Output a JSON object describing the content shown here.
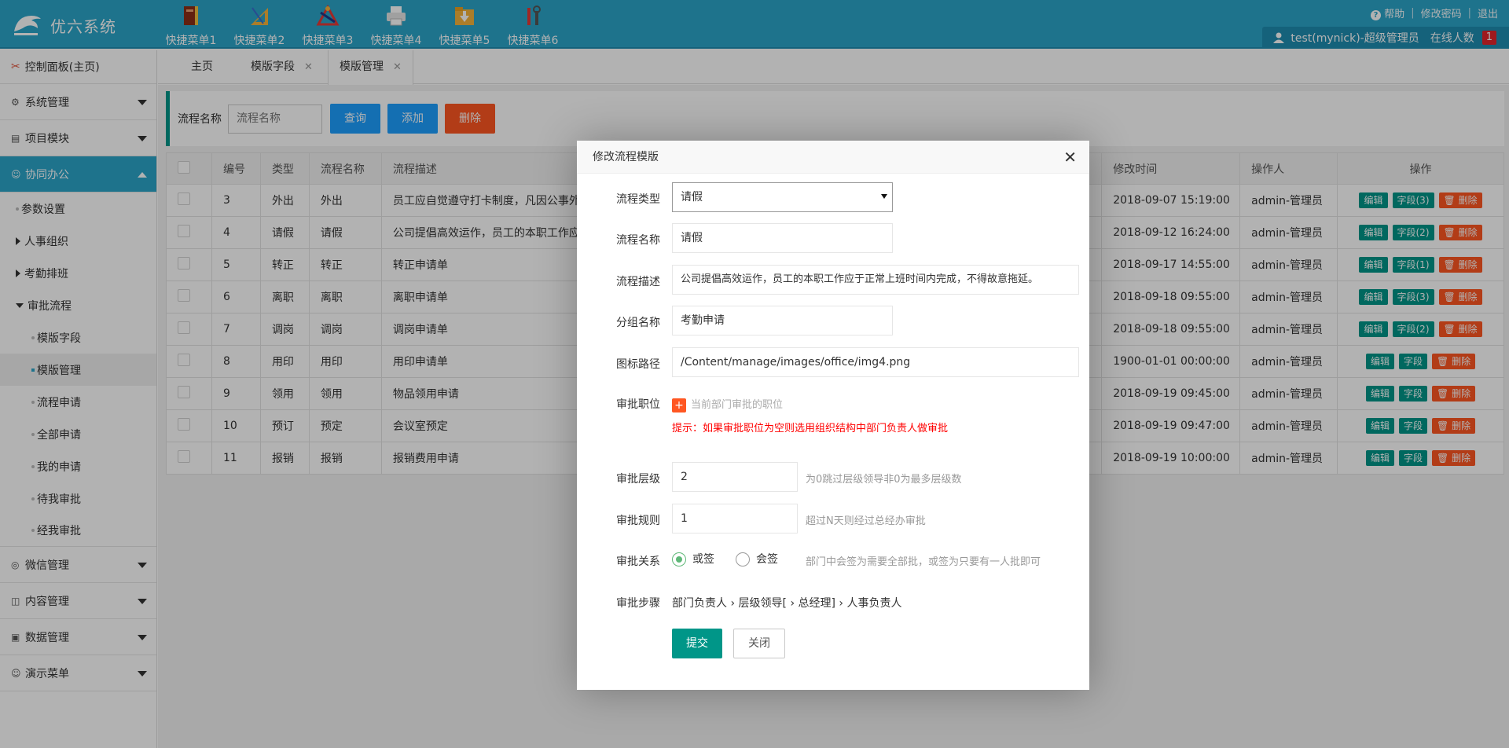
{
  "app": {
    "title": "优六系统",
    "quick_menus": [
      {
        "label": "快捷菜单1",
        "icon": "book-icon"
      },
      {
        "label": "快捷菜单2",
        "icon": "ruler-icon"
      },
      {
        "label": "快捷菜单3",
        "icon": "tools-icon"
      },
      {
        "label": "快捷菜单4",
        "icon": "printer-icon"
      },
      {
        "label": "快捷菜单5",
        "icon": "download-folder-icon"
      },
      {
        "label": "快捷菜单6",
        "icon": "wrench-icon"
      }
    ],
    "top_links": {
      "help": "帮助",
      "change_password": "修改密码",
      "logout": "退出"
    },
    "user": "test(mynick)-超级管理员",
    "online_label": "在线人数",
    "online_count": "1"
  },
  "sidebar": {
    "dashboard": "控制面板(主页)",
    "menus": {
      "system": "系统管理",
      "project": "项目模块",
      "office": "协同办公",
      "wechat": "微信管理",
      "content": "内容管理",
      "data": "数据管理",
      "demo": "演示菜单"
    },
    "office_items": {
      "params": "参数设置",
      "hr": "人事组织",
      "attendance": "考勤排班",
      "approval": "审批流程",
      "template_fields": "模版字段",
      "template_mgmt": "模版管理",
      "flow_apply": "流程申请",
      "all_apply": "全部申请",
      "my_apply": "我的申请",
      "pending": "待我审批",
      "done": "经我审批"
    }
  },
  "tabs": {
    "home": "主页",
    "fields": "模版字段",
    "mgmt": "模版管理"
  },
  "search": {
    "label": "流程名称",
    "placeholder": "流程名称",
    "query": "查询",
    "add": "添加",
    "delete": "删除"
  },
  "table": {
    "headers": {
      "id": "编号",
      "type": "类型",
      "name": "流程名称",
      "desc": "流程描述",
      "time": "修改时间",
      "operator": "操作人",
      "ops": "操作"
    },
    "edit": "编辑",
    "del": "删除",
    "rows": [
      {
        "id": "3",
        "type": "外出",
        "name": "外出",
        "desc": "员工应自觉遵守打卡制度，凡因公事外",
        "time": "2018-09-07 15:19:00",
        "operator": "admin-管理员",
        "field": "字段(3)"
      },
      {
        "id": "4",
        "type": "请假",
        "name": "请假",
        "desc": "公司提倡高效运作，员工的本职工作应",
        "time": "2018-09-12 16:24:00",
        "operator": "admin-管理员",
        "field": "字段(2)"
      },
      {
        "id": "5",
        "type": "转正",
        "name": "转正",
        "desc": "转正申请单",
        "time": "2018-09-17 14:55:00",
        "operator": "admin-管理员",
        "field": "字段(1)"
      },
      {
        "id": "6",
        "type": "离职",
        "name": "离职",
        "desc": "离职申请单",
        "time": "2018-09-18 09:55:00",
        "operator": "admin-管理员",
        "field": "字段(3)"
      },
      {
        "id": "7",
        "type": "调岗",
        "name": "调岗",
        "desc": "调岗申请单",
        "time": "2018-09-18 09:55:00",
        "operator": "admin-管理员",
        "field": "字段(2)"
      },
      {
        "id": "8",
        "type": "用印",
        "name": "用印",
        "desc": "用印申请单",
        "time": "1900-01-01 00:00:00",
        "operator": "admin-管理员",
        "field": "字段"
      },
      {
        "id": "9",
        "type": "领用",
        "name": "领用",
        "desc": "物品领用申请",
        "time": "2018-09-19 09:45:00",
        "operator": "admin-管理员",
        "field": "字段"
      },
      {
        "id": "10",
        "type": "预订",
        "name": "预定",
        "desc": "会议室预定",
        "time": "2018-09-19 09:47:00",
        "operator": "admin-管理员",
        "field": "字段"
      },
      {
        "id": "11",
        "type": "报销",
        "name": "报销",
        "desc": "报销费用申请",
        "time": "2018-09-19 10:00:00",
        "operator": "admin-管理员",
        "field": "字段"
      }
    ]
  },
  "modal": {
    "title": "修改流程模版",
    "flow_type_label": "流程类型",
    "flow_type_value": "请假",
    "flow_name_label": "流程名称",
    "flow_name_value": "请假",
    "flow_desc_label": "流程描述",
    "flow_desc_value": "公司提倡高效运作，员工的本职工作应于正常上班时间内完成，不得故意拖延。",
    "group_label": "分组名称",
    "group_value": "考勤申请",
    "icon_label": "图标路径",
    "icon_value": "/Content/manage/images/office/img4.png",
    "position_label": "审批职位",
    "position_hint": "当前部门审批的职位",
    "position_warn": "提示：如果审批职位为空则选用组织结构中部门负责人做审批",
    "level_label": "审批层级",
    "level_value": "2",
    "level_hint": "为0跳过层级领导非0为最多层级数",
    "rule_label": "审批规则",
    "rule_value": "1",
    "rule_hint": "超过N天则经过总经办审批",
    "relation_label": "审批关系",
    "relation_or": "或签",
    "relation_and": "会签",
    "relation_hint": "部门中会签为需要全部批，或签为只要有一人批即可",
    "steps_label": "审批步骤",
    "steps": [
      "部门负责人",
      "层级领导[",
      "总经理]",
      "人事负责人"
    ],
    "submit": "提交",
    "close": "关闭"
  }
}
